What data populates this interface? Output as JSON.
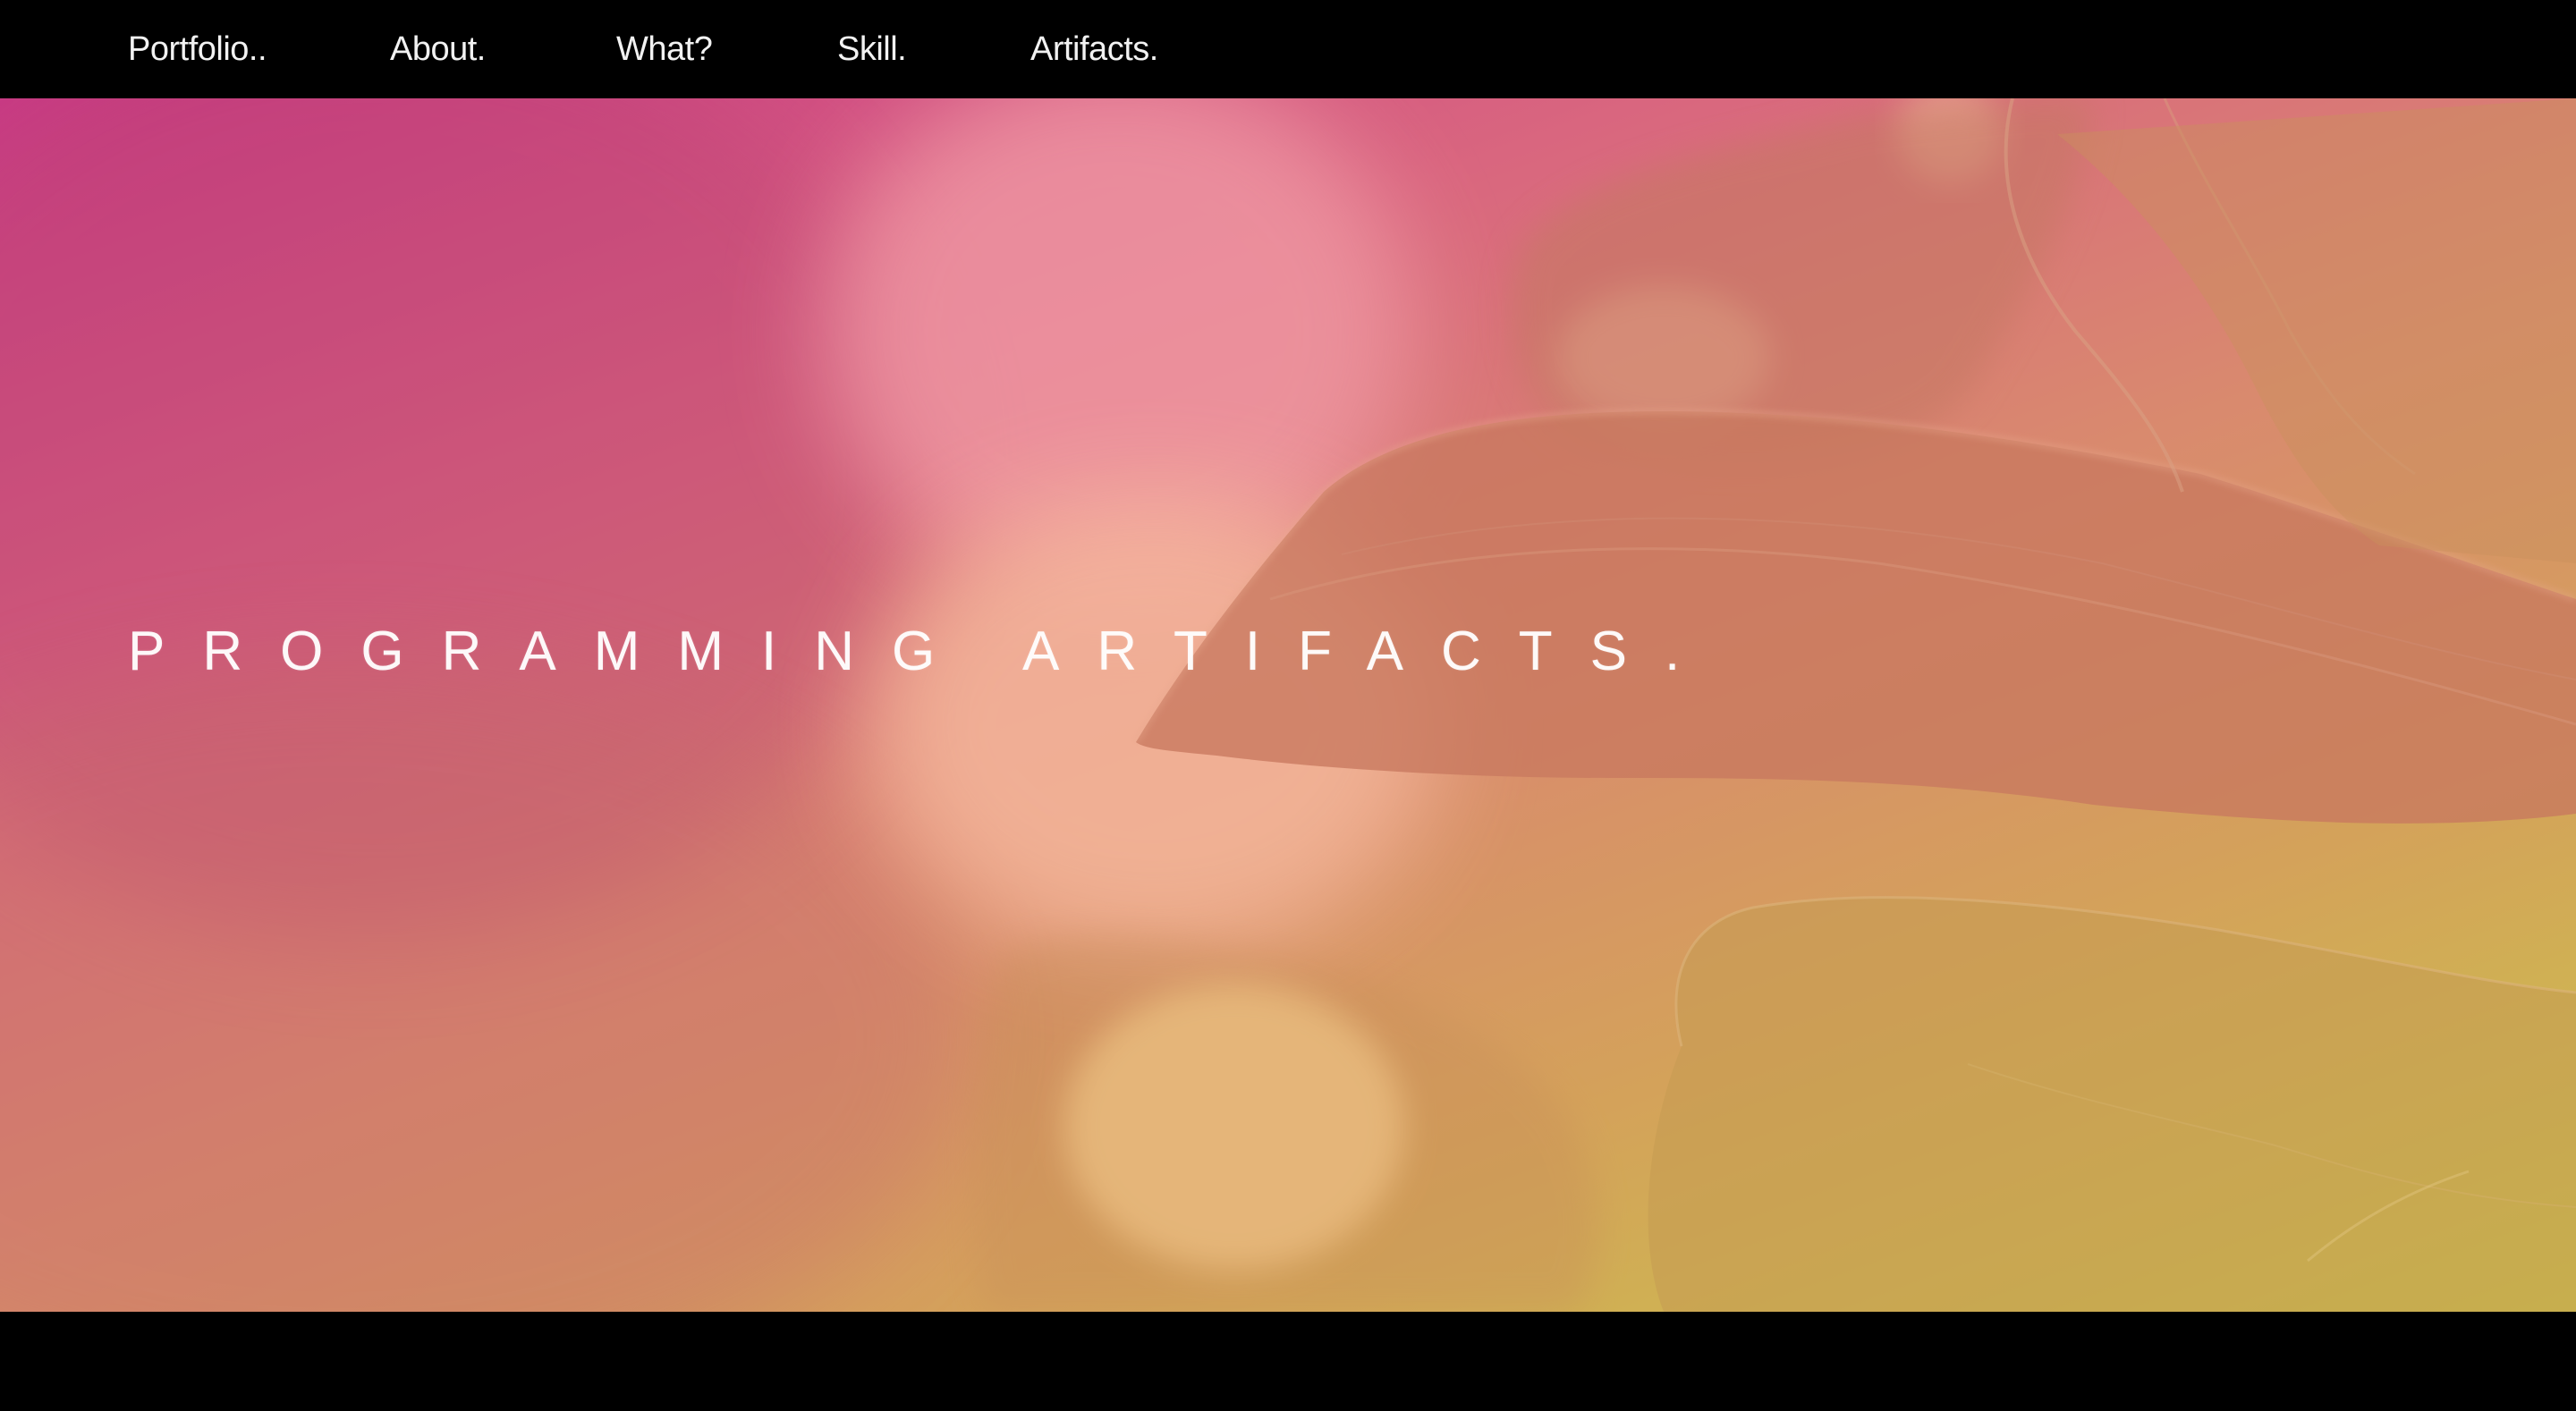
{
  "nav": {
    "items": [
      {
        "label": "Portfolio.."
      },
      {
        "label": "About."
      },
      {
        "label": "What?"
      },
      {
        "label": "Skill."
      },
      {
        "label": "Artifacts."
      }
    ]
  },
  "hero": {
    "title": "PROGRAMMING ARTIFACTS."
  },
  "colors": {
    "nav_background": "#000000",
    "text": "#ffffff",
    "gradient_top_left": "#c93a85",
    "gradient_middle": "#d98a6e",
    "gradient_bottom_right": "#c9c64a"
  }
}
